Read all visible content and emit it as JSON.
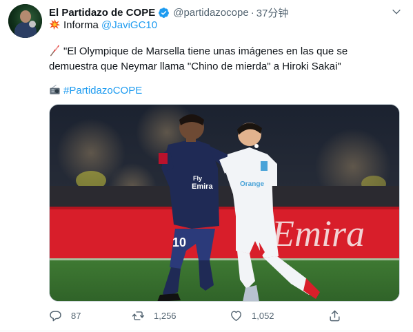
{
  "author": {
    "display_name": "El Partidazo de COPE",
    "handle": "@partidazocope",
    "time": "37分钟",
    "verified": true
  },
  "tweet": {
    "line1_text": "Informa ",
    "line1_mention": "@JaviGC10",
    "line2": "\"El Olympique de Marsella tiene unas imágenes en las que se",
    "line3": "demuestra que Neymar llama \"Chino de mierda\" a Hiroki Sakai\"",
    "hashtag": "#PartidazoCOPE"
  },
  "media": {
    "ad_board_text": "Emira",
    "sponsor_text": "Fly Emirates",
    "jersey_number": "10",
    "sponsor_text_2": "Orange"
  },
  "actions": {
    "replies": "87",
    "retweets": "1,256",
    "likes": "1,052"
  },
  "colors": {
    "accent": "#1d9bf0",
    "secondary_text": "#536471",
    "ad_board_red": "#d81e2a"
  }
}
